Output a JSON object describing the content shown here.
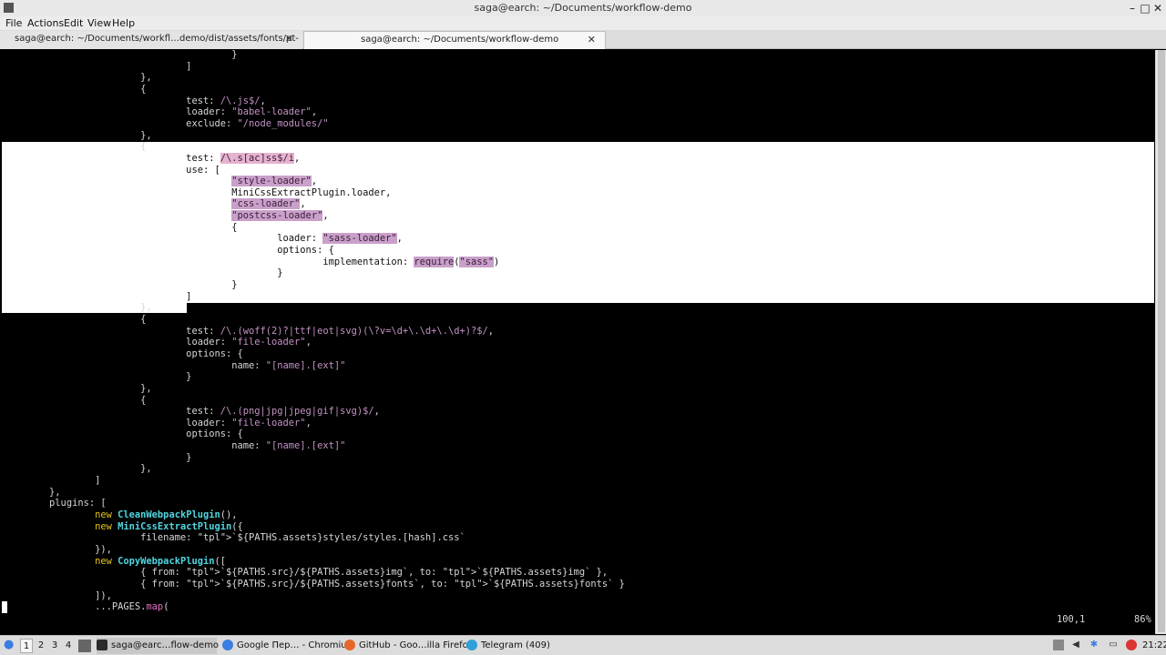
{
  "window": {
    "title": "saga@earch: ~/Documents/workflow-demo",
    "minimize": "–",
    "maximize": "□",
    "close": "✕"
  },
  "menu": [
    "File",
    "Actions",
    "Edit",
    "View",
    "Help"
  ],
  "tabs": [
    {
      "label": "saga@earch: ~/Documents/workfl…demo/dist/assets/fonts/pt-sans",
      "active": false
    },
    {
      "label": "saga@earch: ~/Documents/workflow-demo",
      "active": true
    }
  ],
  "tab_close": "✕",
  "editor": {
    "lines": [
      "                                        }",
      "                                ]",
      "                        },",
      "                        {",
      "                                test: /\\.js$/,",
      "                                loader: \"babel-loader\",",
      "                                exclude: \"/node_modules/\"",
      "                        },",
      "                        {",
      "                                test: /\\.s[ac]ss$/i,",
      "                                use: [",
      "                                        \"style-loader\",",
      "                                        MiniCssExtractPlugin.loader,",
      "                                        \"css-loader\",",
      "                                        \"postcss-loader\",",
      "                                        {",
      "                                                loader: \"sass-loader\",",
      "                                                options: {",
      "                                                        implementation: require(\"sass\")",
      "                                                }",
      "                                        }",
      "                                ]",
      "                        },",
      "                        {",
      "                                test: /\\.(woff(2)?|ttf|eot|svg)(\\?v=\\d+\\.\\d+\\.\\d+)?$/,",
      "                                loader: \"file-loader\",",
      "                                options: {",
      "                                        name: \"[name].[ext]\"",
      "                                }",
      "                        },",
      "                        {",
      "                                test: /\\.(png|jpg|jpeg|gif|svg)$/,",
      "                                loader: \"file-loader\",",
      "                                options: {",
      "                                        name: \"[name].[ext]\"",
      "                                }",
      "                        },",
      "                ]",
      "        },",
      "        plugins: [",
      "                new CleanWebpackPlugin(),",
      "                new MiniCssExtractPlugin({",
      "                        filename: `${PATHS.assets}styles/styles.[hash].css`",
      "                }),",
      "                new CopyWebpackPlugin([",
      "                        { from: `${PATHS.src}/${PATHS.assets}img`, to: `${PATHS.assets}img` },",
      "                        { from: `${PATHS.src}/${PATHS.assets}fonts`, to: `${PATHS.assets}fonts` }",
      "                ]),",
      "                ...PAGES.map("
    ],
    "selected_first_line": 9,
    "selected_last_line": 21,
    "cursor_position": "100,1",
    "scroll_percent": "86%"
  },
  "taskbar": {
    "workspaces": [
      "1",
      "2",
      "3",
      "4"
    ],
    "current_workspace": "1",
    "windows": [
      {
        "label": "saga@earc…flow-demo",
        "icon": "terminal-icon",
        "color": "#2b2b2b"
      },
      {
        "label": "Google Пер… - Chromium",
        "icon": "chromium-icon",
        "color": "#3b7de0"
      },
      {
        "label": "GitHub - Goo…illa Firefox",
        "icon": "firefox-icon",
        "color": "#e5682a"
      },
      {
        "label": "Telegram (409)",
        "icon": "telegram-icon",
        "color": "#2ea0db"
      }
    ],
    "clock": "21:22"
  },
  "colors": {
    "selection_bg": "#ffffff",
    "string": "#c392c4",
    "keyword": "#e6c619",
    "class_name": "#4fd6e0",
    "method": "#e070c0"
  }
}
